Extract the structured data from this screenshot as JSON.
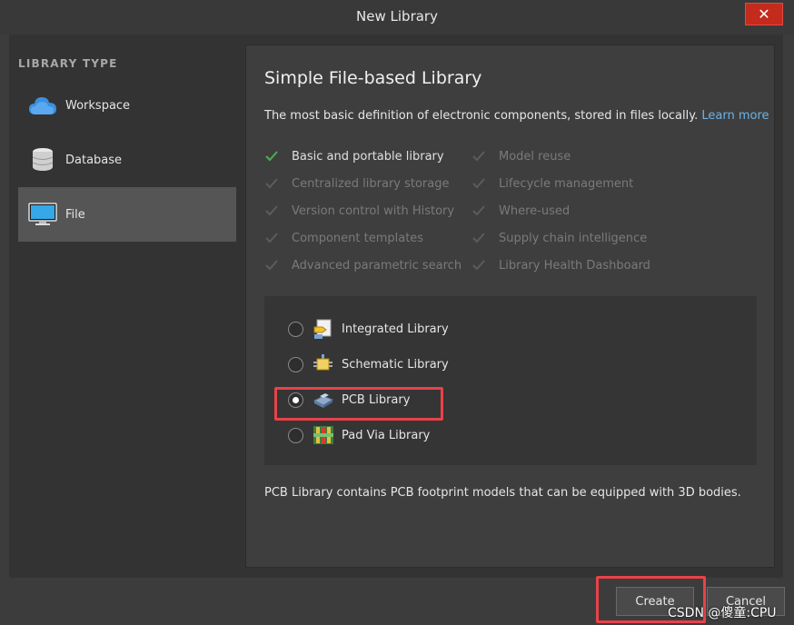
{
  "window": {
    "title": "New Library"
  },
  "sidebar": {
    "heading": "LIBRARY TYPE",
    "items": [
      {
        "label": "Workspace",
        "icon": "cloud-icon"
      },
      {
        "label": "Database",
        "icon": "database-icon"
      },
      {
        "label": "File",
        "icon": "monitor-icon",
        "active": true
      }
    ]
  },
  "main": {
    "title": "Simple File-based Library",
    "description": "The most basic definition of electronic components, stored in files locally.",
    "learn_more": "Learn more",
    "features_left": [
      {
        "label": "Basic and portable library",
        "enabled": true
      },
      {
        "label": "Centralized library storage",
        "enabled": false
      },
      {
        "label": "Version control with History",
        "enabled": false
      },
      {
        "label": "Component templates",
        "enabled": false
      },
      {
        "label": "Advanced parametric search",
        "enabled": false
      }
    ],
    "features_right": [
      {
        "label": "Model reuse",
        "enabled": false
      },
      {
        "label": "Lifecycle management",
        "enabled": false
      },
      {
        "label": "Where-used",
        "enabled": false
      },
      {
        "label": "Supply chain intelligence",
        "enabled": false
      },
      {
        "label": "Library Health Dashboard",
        "enabled": false
      }
    ],
    "library_options": [
      {
        "label": "Integrated Library",
        "icon": "integrated-library-icon",
        "selected": false
      },
      {
        "label": "Schematic Library",
        "icon": "schematic-library-icon",
        "selected": false
      },
      {
        "label": "PCB Library",
        "icon": "pcb-library-icon",
        "selected": true
      },
      {
        "label": "Pad Via Library",
        "icon": "pad-via-library-icon",
        "selected": false
      }
    ],
    "selection_note": "PCB Library contains PCB footprint models that can be equipped with 3D bodies."
  },
  "buttons": {
    "create": "Create",
    "cancel": "Cancel",
    "close": "✕"
  },
  "watermark": "CSDN @傻童:CPU",
  "colors": {
    "accent_link": "#6cb3e8",
    "check_on": "#4caf50",
    "highlight": "#e8424a",
    "close_bg": "#c42b1c"
  }
}
